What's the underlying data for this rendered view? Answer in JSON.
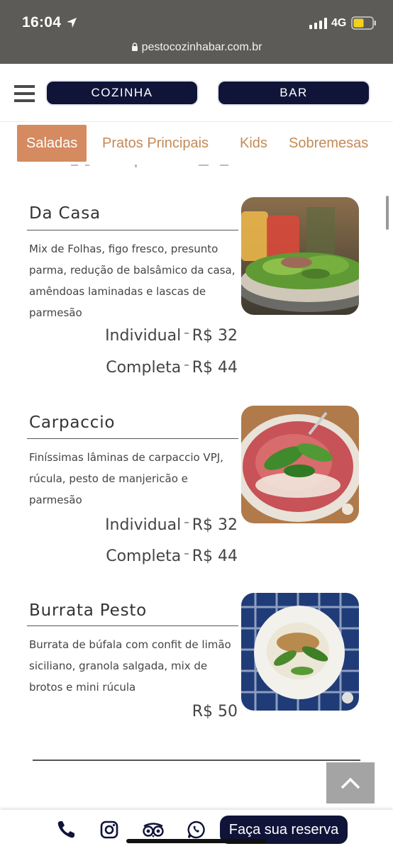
{
  "status_bar": {
    "time": "16:04",
    "network": "4G",
    "url": "pestocozinhabar.com.br"
  },
  "header": {
    "menu_icon": "hamburger-icon",
    "nav": [
      {
        "label": "COZINHA"
      },
      {
        "label": "BAR"
      }
    ]
  },
  "tabs": [
    {
      "label": "Saladas",
      "active": true
    },
    {
      "label": "Pratos Principais",
      "active": false
    },
    {
      "label": "Kids",
      "active": false
    },
    {
      "label": "Sobremesas",
      "active": false
    }
  ],
  "menu_items": [
    {
      "title": "Da Casa",
      "description": "Mix de Folhas, figo fresco, presunto parma, redução de balsâmico da casa, amêndoas laminadas e lascas de parmesão",
      "prices": [
        {
          "size": "Individual",
          "separator": "–",
          "value": "R$ 32"
        },
        {
          "size": "Completa",
          "separator": "–",
          "value": "R$ 44"
        }
      ]
    },
    {
      "title": "Carpaccio",
      "description": "Finíssimas lâminas de carpaccio VPJ, rúcula, pesto de manjericão e parmesão",
      "prices": [
        {
          "size": "Individual",
          "separator": "–",
          "value": "R$ 32"
        },
        {
          "size": "Completa",
          "separator": "–",
          "value": "R$ 44"
        }
      ]
    },
    {
      "title": "Burrata Pesto",
      "description": "Burrata de búfala com confit de limão siciliano, granola salgada, mix de brotos e mini rúcula",
      "prices": [
        {
          "value": "R$ 50"
        }
      ]
    }
  ],
  "bottom_bar": {
    "icons": [
      "phone-icon",
      "instagram-icon",
      "tripadvisor-icon",
      "whatsapp-icon"
    ],
    "reserve_label": "Faça sua reserva"
  },
  "colors": {
    "navy": "#0f1438",
    "accent": "#d58a60",
    "tab_text": "#c48a56"
  }
}
